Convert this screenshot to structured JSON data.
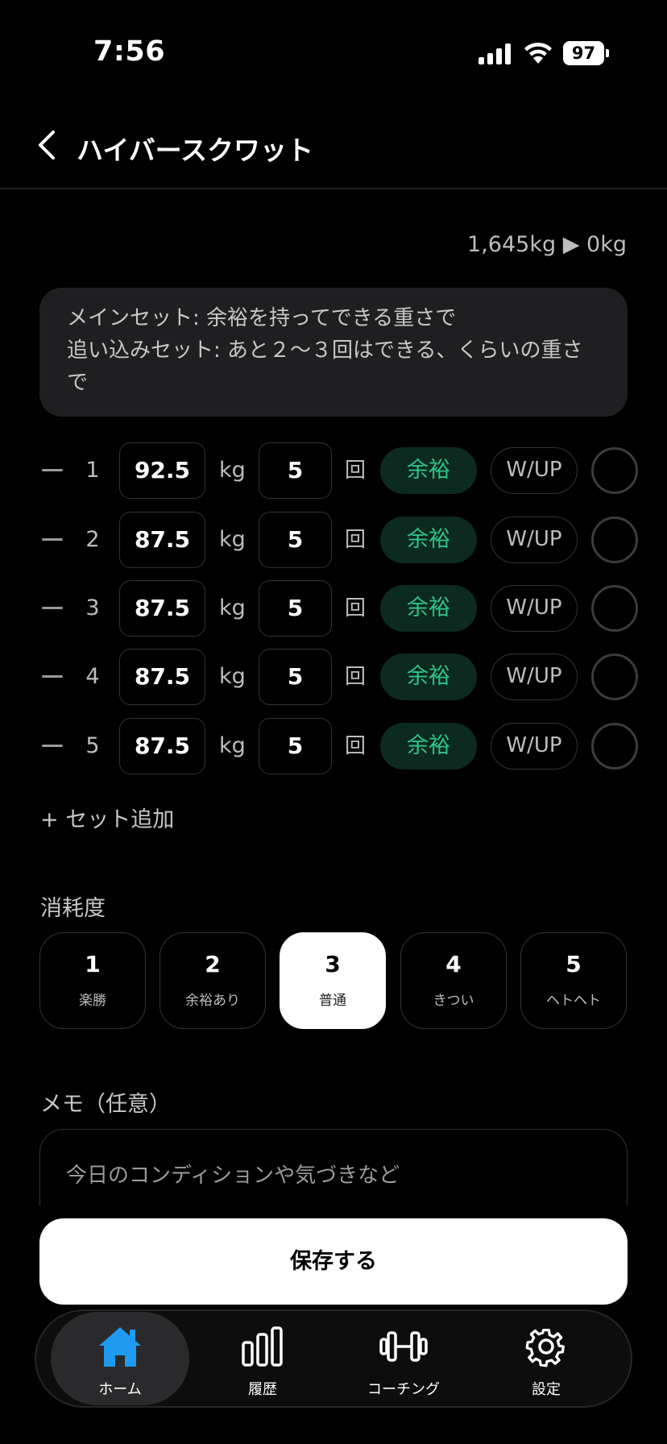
{
  "status_bar": {
    "time": "7:56",
    "battery": "97"
  },
  "header": {
    "title": "ハイバースクワット"
  },
  "volume": "1,645kg ▶ 0kg",
  "guidance": {
    "line1": "メインセット: 余裕を持ってできる重さで",
    "line2": "追い込みセット: あと２〜３回はできる、くらいの重さで"
  },
  "units": {
    "weight": "kg",
    "reps": "回"
  },
  "sets": [
    {
      "number": "1",
      "weight": "92.5",
      "reps": "5",
      "intensity": "余裕",
      "warmup": "W/UP"
    },
    {
      "number": "2",
      "weight": "87.5",
      "reps": "5",
      "intensity": "余裕",
      "warmup": "W/UP"
    },
    {
      "number": "3",
      "weight": "87.5",
      "reps": "5",
      "intensity": "余裕",
      "warmup": "W/UP"
    },
    {
      "number": "4",
      "weight": "87.5",
      "reps": "5",
      "intensity": "余裕",
      "warmup": "W/UP"
    },
    {
      "number": "5",
      "weight": "87.5",
      "reps": "5",
      "intensity": "余裕",
      "warmup": "W/UP"
    }
  ],
  "add_set_label": "+ セット追加",
  "fatigue": {
    "label": "消耗度",
    "selected": 3,
    "options": [
      {
        "value": "1",
        "label": "楽勝"
      },
      {
        "value": "2",
        "label": "余裕あり"
      },
      {
        "value": "3",
        "label": "普通"
      },
      {
        "value": "4",
        "label": "きつい"
      },
      {
        "value": "5",
        "label": "ヘトヘト"
      }
    ]
  },
  "memo": {
    "label": "メモ（任意）",
    "placeholder": "今日のコンディションや気づきなど",
    "value": ""
  },
  "save_label": "保存する",
  "colors": {
    "accent_blue": "#1e9bf0",
    "intensity_green": "#2fc48b"
  },
  "tabs": [
    {
      "label": "ホーム",
      "icon": "home-icon",
      "active": true
    },
    {
      "label": "履歴",
      "icon": "bar-chart-icon",
      "active": false
    },
    {
      "label": "コーチング",
      "icon": "dumbbell-icon",
      "active": false
    },
    {
      "label": "設定",
      "icon": "gear-icon",
      "active": false
    }
  ]
}
